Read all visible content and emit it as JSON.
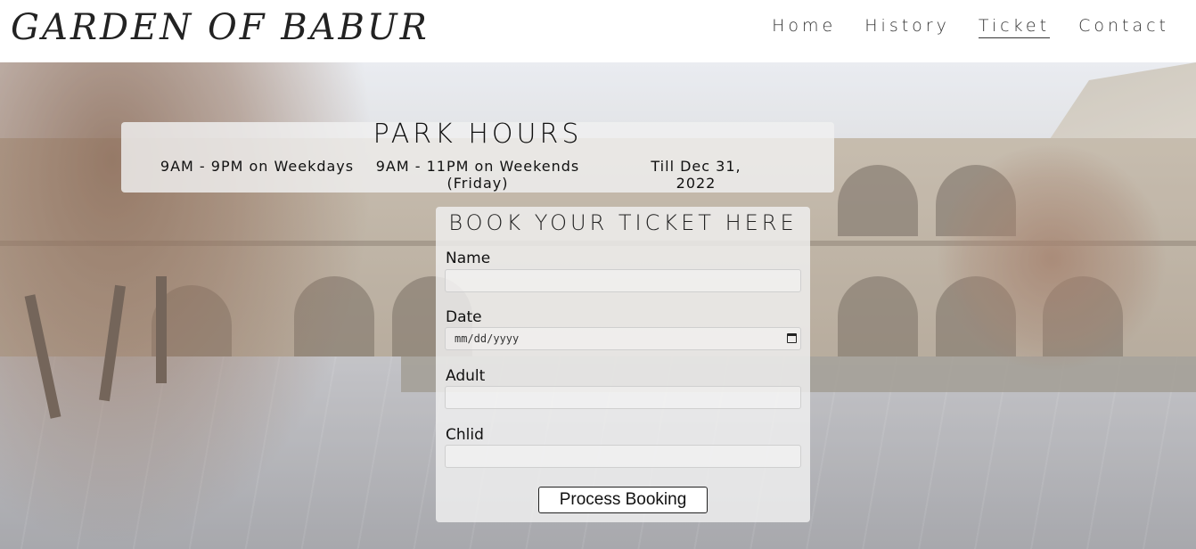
{
  "header": {
    "logo": "GARDEN OF BABUR",
    "nav": [
      {
        "label": "Home"
      },
      {
        "label": "History"
      },
      {
        "label": "Ticket",
        "active": true
      },
      {
        "label": "Contact"
      }
    ]
  },
  "park_hours": {
    "title": "PARK HOURS",
    "weekdays": "9AM - 9PM on Weekdays",
    "weekends": "9AM - 11PM on Weekends (Friday)",
    "until": "Till Dec 31, 2022"
  },
  "booking": {
    "title": "BOOK YOUR TICKET HERE",
    "name_label": "Name",
    "date_label": "Date",
    "date_placeholder": "mm/dd/yyyy",
    "adult_label": "Adult",
    "child_label": "Chlid",
    "submit_label": "Process Booking"
  },
  "icons": {
    "calendar": "calendar-icon"
  }
}
